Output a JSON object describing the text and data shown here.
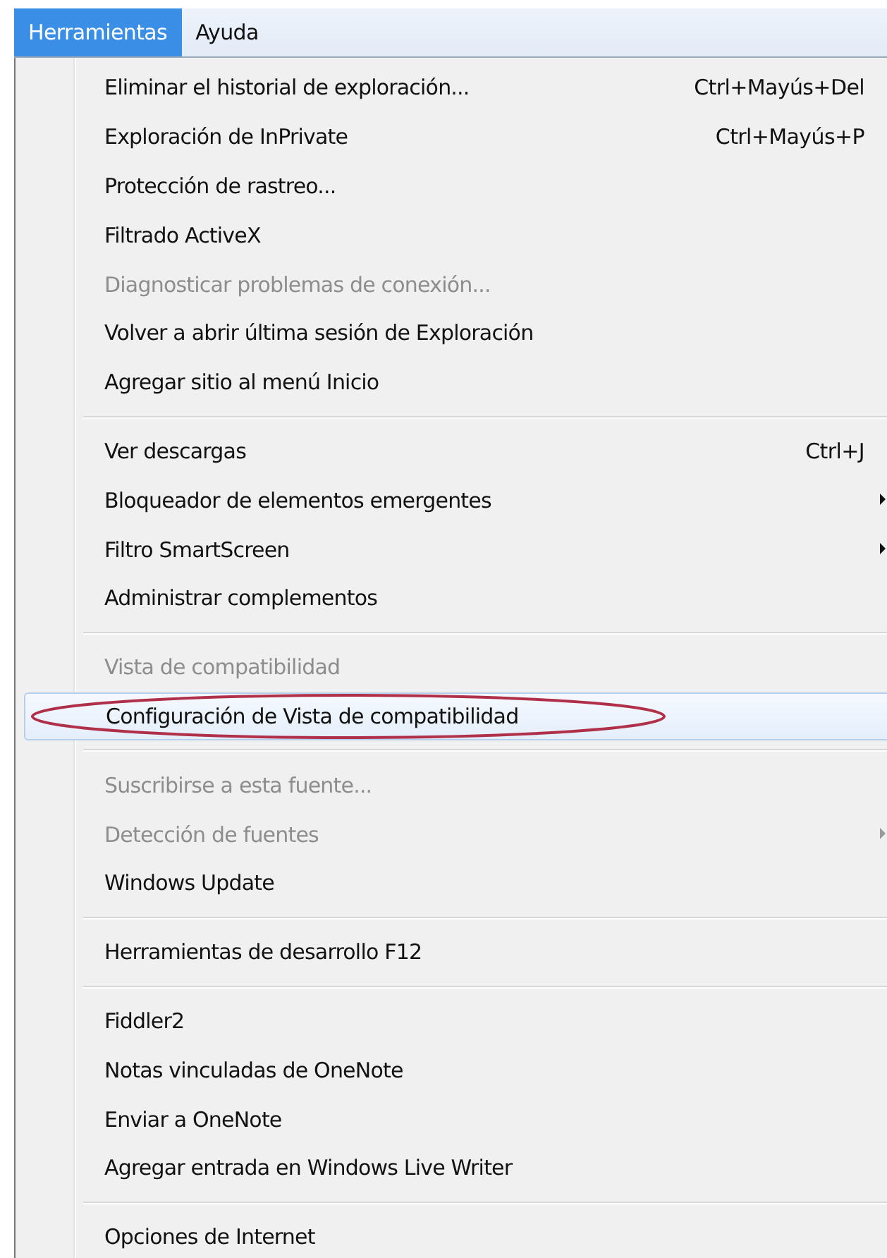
{
  "menu_bar": [
    {
      "label": "Herramientas",
      "selected": true
    },
    {
      "label": "Ayuda",
      "selected": false
    }
  ],
  "menu": {
    "groups": [
      {
        "items": [
          {
            "label": "Eliminar el historial de exploración...",
            "shortcut": "Ctrl+Mayús+Del",
            "disabled": false,
            "submenu": false,
            "selected": false,
            "circled": false
          },
          {
            "label": "Exploración de InPrivate",
            "shortcut": "Ctrl+Mayús+P",
            "disabled": false,
            "submenu": false,
            "selected": false,
            "circled": false
          },
          {
            "label": "Protección de rastreo...",
            "disabled": false,
            "submenu": false,
            "selected": false,
            "circled": false
          },
          {
            "label": "Filtrado ActiveX",
            "disabled": false,
            "submenu": false,
            "selected": false,
            "circled": false
          },
          {
            "label": "Diagnosticar problemas de conexión...",
            "disabled": true,
            "submenu": false,
            "selected": false,
            "circled": false
          },
          {
            "label": "Volver a abrir última sesión de Exploración",
            "disabled": false,
            "submenu": false,
            "selected": false,
            "circled": false
          },
          {
            "label": "Agregar sitio al menú Inicio",
            "disabled": false,
            "submenu": false,
            "selected": false,
            "circled": false
          }
        ]
      },
      {
        "items": [
          {
            "label": "Ver descargas",
            "shortcut": "Ctrl+J",
            "disabled": false,
            "submenu": false,
            "selected": false,
            "circled": false
          },
          {
            "label": "Bloqueador de elementos emergentes",
            "disabled": false,
            "submenu": true,
            "selected": false,
            "circled": false
          },
          {
            "label": "Filtro SmartScreen",
            "disabled": false,
            "submenu": true,
            "selected": false,
            "circled": false
          },
          {
            "label": "Administrar complementos",
            "disabled": false,
            "submenu": false,
            "selected": false,
            "circled": false
          }
        ]
      },
      {
        "items": [
          {
            "label": "Vista de compatibilidad",
            "disabled": true,
            "submenu": false,
            "selected": false,
            "circled": false
          },
          {
            "label": "Configuración de Vista de compatibilidad",
            "disabled": false,
            "submenu": false,
            "selected": true,
            "circled": true
          }
        ]
      },
      {
        "items": [
          {
            "label": "Suscribirse a esta fuente...",
            "disabled": true,
            "submenu": false,
            "selected": false,
            "circled": false
          },
          {
            "label": "Detección de fuentes",
            "disabled": true,
            "submenu": true,
            "selected": false,
            "circled": false
          },
          {
            "label": "Windows Update",
            "disabled": false,
            "submenu": false,
            "selected": false,
            "circled": false
          }
        ]
      },
      {
        "items": [
          {
            "label": "Herramientas de desarrollo F12",
            "disabled": false,
            "submenu": false,
            "selected": false,
            "circled": false
          }
        ]
      },
      {
        "items": [
          {
            "label": "Fiddler2",
            "disabled": false,
            "submenu": false,
            "selected": false,
            "circled": false
          },
          {
            "label": "Notas vinculadas de OneNote",
            "disabled": false,
            "submenu": false,
            "selected": false,
            "circled": false
          },
          {
            "label": "Enviar a OneNote",
            "disabled": false,
            "submenu": false,
            "selected": false,
            "circled": false
          },
          {
            "label": "Agregar entrada en Windows Live Writer",
            "disabled": false,
            "submenu": false,
            "selected": false,
            "circled": false
          }
        ]
      },
      {
        "items": [
          {
            "label": "Opciones de Internet",
            "disabled": false,
            "submenu": false,
            "selected": false,
            "circled": false
          }
        ]
      }
    ]
  }
}
